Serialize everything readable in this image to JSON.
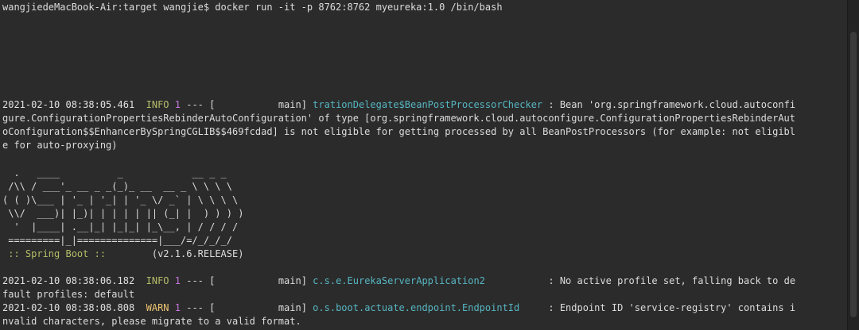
{
  "prompt_line": "wangjiedeMacBook-Air:target wangjie$ docker run -it -p 8762:8762 myeureka:1.0 /bin/bash",
  "log1": {
    "timestamp": "2021-02-10 08:38:05.461",
    "level": "INFO",
    "pid": "1",
    "sep": " --- [           main] ",
    "logger": "trationDelegate$BeanPostProcessorChecker",
    "msg_first": " : Bean 'org.springframework.cloud.autoconfi",
    "cont": [
      "gure.ConfigurationPropertiesRebinderAutoConfiguration' of type [org.springframework.cloud.autoconfigure.ConfigurationPropertiesRebinderAut",
      "oConfiguration$$EnhancerBySpringCGLIB$$469fcdad] is not eligible for getting processed by all BeanPostProcessors (for example: not eligibl",
      "e for auto-proxying)"
    ]
  },
  "banner": [
    "  .   ____          _            __ _ _",
    " /\\\\ / ___'_ __ _ _(_)_ __  __ _ \\ \\ \\ \\",
    "( ( )\\___ | '_ | '_| | '_ \\/ _` | \\ \\ \\ \\",
    " \\\\/  ___)| |_)| | | | | || (_| |  ) ) ) )",
    "  '  |____| .__|_| |_|_| |_\\__, | / / / /",
    " =========|_|==============|___/=/_/_/_/"
  ],
  "boot_label": " :: Spring Boot :: ",
  "boot_version": "       (v2.1.6.RELEASE)",
  "log2": {
    "timestamp": "2021-02-10 08:38:06.182",
    "level": "INFO",
    "pid": "1",
    "sep": " --- [           main] ",
    "logger": "c.s.e.EurekaServerApplication2          ",
    "msg_first": " : No active profile set, falling back to de",
    "cont": "fault profiles: default"
  },
  "log3": {
    "timestamp": "2021-02-10 08:38:08.808",
    "level": "WARN",
    "pid": "1",
    "sep": " --- [           main] ",
    "logger": "o.s.boot.actuate.endpoint.EndpointId    ",
    "msg_first": " : Endpoint ID 'service-registry' contains i",
    "cont": "nvalid characters, please migrate to a valid format."
  },
  "colors": {
    "background": "#2b2b2b",
    "info": "#b5bd68",
    "warn": "#f0c674",
    "pid": "#c678dd",
    "logger": "#56b6c2"
  }
}
